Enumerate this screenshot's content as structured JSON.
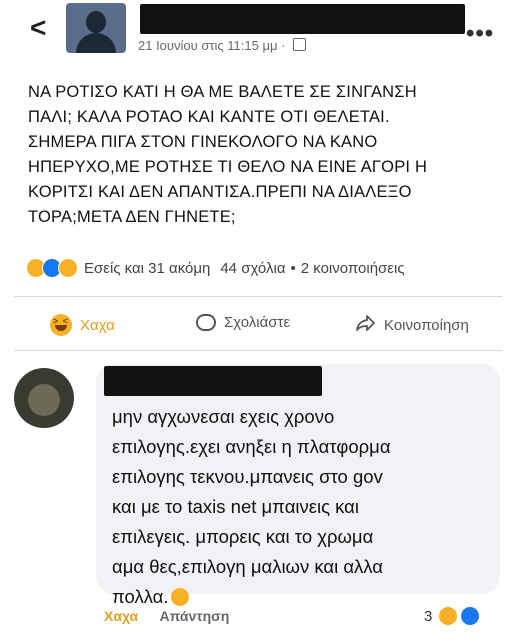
{
  "header": {
    "back_icon": "back-arrow-icon",
    "timestamp": "21 Ιουνίου στις 11:15 μμ",
    "separator": "·",
    "privacy_icon": "audience-icon",
    "more_icon": "more-dots-icon",
    "more_label": "•••"
  },
  "post": {
    "text": "ΝΑ ΡΟΤΙΣΟ ΚΑΤΙ Η ΘΑ ΜΕ ΒΑΛΕΤΕ ΣΕ ΣΙΝΓΑΝΣΗ\nΠΑΛΙ; ΚΑΛΑ ΡΟΤΑΟ ΚΑΙ ΚΑΝΤΕ ΟΤΙ ΘΕΛΕΤΑΙ.\nΣΗΜΕΡΑ ΠΙΓΑ ΣΤΟΝ ΓΙΝΕΚΟΛΟΓΟ ΝΑ ΚΑΝΟ\nΗΠΕΡΥΧΟ,ΜΕ ΡΟΤΗΣΕ ΤΙ ΘΕΛΟ ΝΑ ΕΙΝΕ ΑΓΟΡΙ Η\nΚΟΡΙΤΣΙ ΚΑΙ ΔΕΝ ΑΠΑΝΤΙΣΑ.ΠΡΕΠΙ ΝΑ ΔΙΑΛΕΞΟ\nΤΟΡΑ;ΜΕΤΑ ΔΕΝ ΓΗΝΕΤΕ;"
  },
  "reactions": {
    "summary": "Εσείς και 31 ακόμη",
    "comments": "44 σχόλια",
    "dot": "•",
    "shares": "2 κοινοποιήσεις",
    "icons": [
      "haha-icon",
      "like-icon",
      "wow-icon"
    ]
  },
  "actions": {
    "haha_label": "Χαχα",
    "comment_label": "Σχολιάστε",
    "share_label": "Κοινοποίηση"
  },
  "comment": {
    "text": "μην αγχωνεσαι εχεις χρονο\nεπιλογης.εχει ανηξει η πλατφορμα\nεπιλογης τεκνου.μπανεις στο gov\nκαι με το taxis  net μπαινεις και\nεπιλεγεις. μπορεις και το χρωμα\nαμα θες,επιλογη μαλιων και αλλα\nπολλα.",
    "haha_label": "Χαχα",
    "reply_label": "Απάντηση",
    "reaction_count": "3"
  },
  "colors": {
    "haha": "#f7b125",
    "like": "#1877f2",
    "bubble": "#f0f2f5",
    "meta": "#65676b"
  }
}
